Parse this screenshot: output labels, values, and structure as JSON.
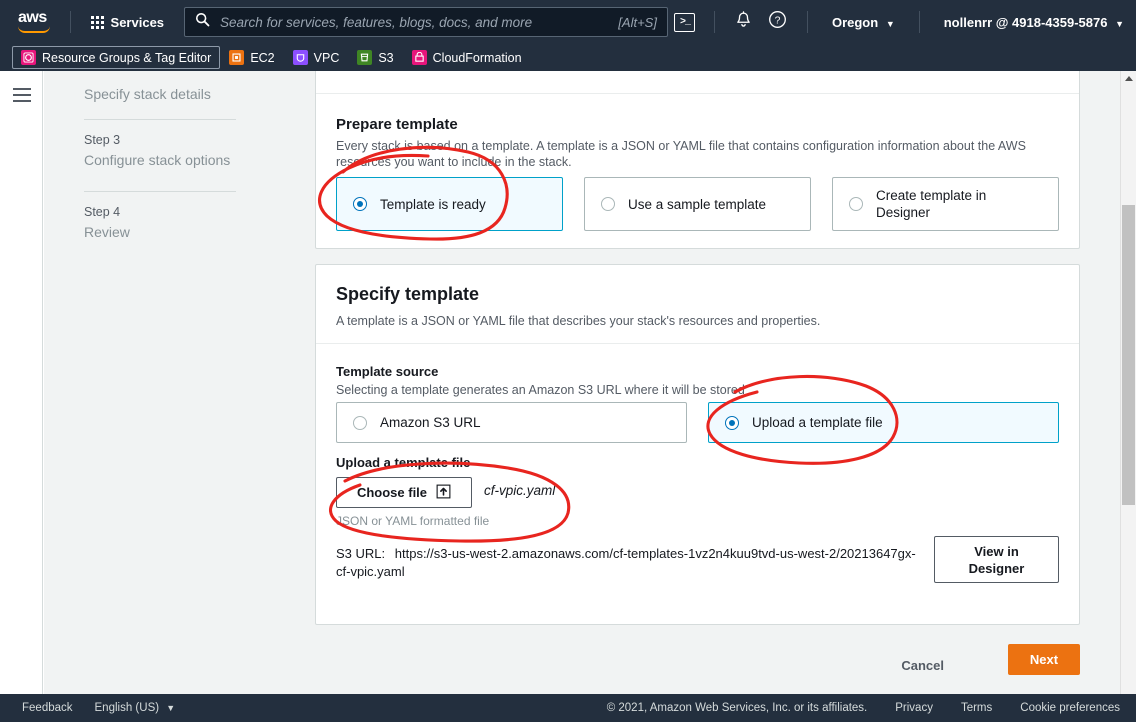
{
  "topnav": {
    "logo_text": "aws",
    "services_label": "Services",
    "services_icon": "grid-icon",
    "search_icon": "search-icon",
    "search_placeholder": "Search for services, features, blogs, docs, and more",
    "search_value": "",
    "search_shortcut": "[Alt+S]",
    "cloudshell_icon": "cloudshell-icon",
    "cloudshell_glyph": ">_",
    "notifications_icon": "bell-icon",
    "help_icon": "question-circle-icon",
    "region_label": "Oregon",
    "account_label": "nollenrr @ 4918-4359-5876",
    "caret": "▼"
  },
  "favbar": {
    "items": [
      {
        "label": "Resource Groups & Tag Editor",
        "icon": "resource-groups-icon",
        "color": "#e7157b",
        "active": true
      },
      {
        "label": "EC2",
        "icon": "ec2-icon",
        "color": "#ec7211",
        "active": false
      },
      {
        "label": "VPC",
        "icon": "vpc-icon",
        "color": "#8c4fff",
        "active": false
      },
      {
        "label": "S3",
        "icon": "s3-icon",
        "color": "#3f8624",
        "active": false
      },
      {
        "label": "CloudFormation",
        "icon": "cloudformation-icon",
        "color": "#e7157b",
        "active": false
      }
    ]
  },
  "leftrail": {
    "menu_icon": "hamburger-menu-icon"
  },
  "wizard": {
    "current_step_label": "Specify stack details",
    "steps": [
      {
        "num": "Step 3",
        "label": "Configure stack options"
      },
      {
        "num": "Step 4",
        "label": "Review"
      }
    ]
  },
  "prepare_template": {
    "heading": "Prepare template",
    "description": "Every stack is based on a template. A template is a JSON or YAML file that contains configuration information about the AWS resources you want to include in the stack.",
    "options": [
      {
        "label": "Template is ready",
        "selected": true
      },
      {
        "label": "Use a sample template",
        "selected": false
      },
      {
        "label": "Create template in Designer",
        "selected": false
      }
    ]
  },
  "specify_template": {
    "heading": "Specify template",
    "description": "A template is a JSON or YAML file that describes your stack's resources and properties.",
    "source_label": "Template source",
    "source_description": "Selecting a template generates an Amazon S3 URL where it will be stored",
    "source_options": [
      {
        "label": "Amazon S3 URL",
        "selected": false
      },
      {
        "label": "Upload a template file",
        "selected": true
      }
    ],
    "upload_label": "Upload a template file",
    "choose_file_button": "Choose file",
    "choose_file_icon": "upload-icon",
    "chosen_file_name": "cf-vpic.yaml",
    "upload_hint": "JSON or YAML formatted file",
    "s3_url_label": "S3 URL:",
    "s3_url_value": "https://s3-us-west-2.amazonaws.com/cf-templates-1vz2n4kuu9tvd-us-west-2/20213647gx-cf-vpic.yaml",
    "view_in_designer_line1": "View in",
    "view_in_designer_line2": "Designer"
  },
  "actions": {
    "cancel_label": "Cancel",
    "next_label": "Next"
  },
  "footer": {
    "feedback_label": "Feedback",
    "language_label": "English (US)",
    "caret": "▼",
    "copyright": "© 2021, Amazon Web Services, Inc. or its affiliates.",
    "privacy_label": "Privacy",
    "terms_label": "Terms",
    "cookie_label": "Cookie preferences"
  },
  "colors": {
    "nav_bg": "#232f3e",
    "accent_orange": "#ec7211",
    "selected_blue": "#0073bb",
    "selected_tile_bg": "#f1faff",
    "selected_tile_border": "#00a1c9",
    "annotation_red": "#e8251f"
  },
  "scrollbar": {
    "up_arrow_icon": "scroll-up-arrow-icon",
    "thumb": "scroll-thumb"
  },
  "annotations": {
    "note": "hand-drawn red circles",
    "circles": [
      "template-is-ready-tile",
      "upload-a-template-file-tile",
      "choose-file-and-filename"
    ]
  }
}
